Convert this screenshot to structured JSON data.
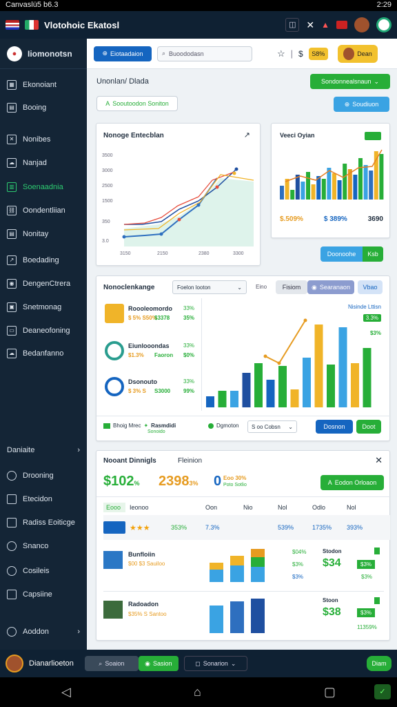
{
  "status_bar": {
    "left": "Canvaslü5 b6.3",
    "time": "2:29"
  },
  "app": {
    "title": "Vlotohoic Ekatosl"
  },
  "sidebar": {
    "brand": "Iiomonotsn",
    "items": [
      {
        "label": "Ekonoiant",
        "icon": "dashboard-icon"
      },
      {
        "label": "Booing",
        "icon": "calendar-icon"
      },
      {
        "label": "Nonibes",
        "icon": "close-box-icon"
      },
      {
        "label": "Nanjad",
        "icon": "cloud-icon"
      },
      {
        "label": "Soenaadnia",
        "icon": "chart-icon",
        "active": true
      },
      {
        "label": "Oondentliian",
        "icon": "link-icon"
      },
      {
        "label": "Nonitay",
        "icon": "document-icon"
      },
      {
        "label": "Boedading",
        "icon": "share-icon"
      },
      {
        "label": "DengenCtrera",
        "icon": "group-icon"
      },
      {
        "label": "Snetmonag",
        "icon": "image-icon"
      },
      {
        "label": "Deaneofoning",
        "icon": "card-icon"
      },
      {
        "label": "Bedanfanno",
        "icon": "cloud-upload-icon"
      }
    ],
    "section_title": "Daniaite",
    "sub_items": [
      {
        "label": "Drooning",
        "icon": "clock-icon"
      },
      {
        "label": "Etecidon",
        "icon": "list-icon"
      },
      {
        "label": "Radiss Eoiticge",
        "icon": "laptop-icon"
      },
      {
        "label": "Snanco",
        "icon": "target-icon"
      },
      {
        "label": "Cosileis",
        "icon": "gear-icon"
      },
      {
        "label": "Capsiine",
        "icon": "layers-icon"
      }
    ],
    "footer_item": "Aoddon"
  },
  "topbar": {
    "primary_button": "Eiotaadaion",
    "search_placeholder": "Buoododasn",
    "badge": "S8%",
    "profile_label": "Dean"
  },
  "page": {
    "title": "Unonlan/ Dlada",
    "action_button": "Sondonnealsnaun",
    "chip_label": "Sooutoodon Soniton",
    "secondary_button": "Soudiuon"
  },
  "card1": {
    "title": "Nonoge Entecblan",
    "yticks": [
      "3500",
      "3000",
      "2500",
      "1500",
      "350",
      "3.0"
    ],
    "xticks": [
      "3150",
      "2150",
      "2380",
      "3300"
    ]
  },
  "card2": {
    "title": "Veeci Oyian",
    "badge": "",
    "stats": [
      {
        "v": "$.509%",
        "c": "#e69b20"
      },
      {
        "v": "$ 389%",
        "c": "#1565c0"
      },
      {
        "v": "3690",
        "c": "#1f2d3d"
      }
    ],
    "btn_a": "Doonoohe",
    "btn_b": "Ksb"
  },
  "card3": {
    "title": "Nonoclenkange",
    "dropdown": "Foelon looton",
    "filter_label": "Eino",
    "filter_button": "Fisiom",
    "toggle_label": "Searanaon",
    "view_button": "Vbao",
    "legend_title": "Nisinde Lttisn",
    "legend_value": "3.3%",
    "legend_sub": "$3%",
    "items": [
      {
        "name": "Roooleomordo",
        "sub": "$ 5% S50%",
        "v1": "$3378",
        "p1": "33%",
        "p2": "35%"
      },
      {
        "name": "Eiunlooondas",
        "sub": "$1.3%",
        "v1": "Faoron",
        "p1": "33%",
        "p2": "$0%"
      },
      {
        "name": "Dsonouto",
        "sub": "$ 3% S",
        "v1": "S3000",
        "p1": "33%",
        "p2": "99%"
      }
    ],
    "footer_left": "Bhoig Mrec",
    "footer_left2": "Rasmdidi",
    "footer_left_sub": "Sonoido",
    "footer_mid": "Dgmoton",
    "footer_select": "S oo Cobsn",
    "footer_btn1": "Dosnon",
    "footer_btn2": "Doot"
  },
  "card4": {
    "title": "Nooant Dinnigls",
    "title2": "Fleinion",
    "stat1": "$102",
    "stat1_sub": "%",
    "stat2": "2398",
    "stat2_sub": "3%",
    "stat3": "0",
    "stat3_sub": "Eoo 30%",
    "stat3_sub2": "Poto Sotlio",
    "button": "Eodon Orloaon",
    "table_head": [
      "Eooo",
      "Ieonoo",
      "Oon",
      "Nio",
      "Nol",
      "Odlo",
      "Nol"
    ],
    "row1": {
      "stars": "★★★",
      "pct": "353%",
      "c1": "7.3%",
      "c2": "539%",
      "c3": "1735%",
      "c4": "393%"
    },
    "row2": {
      "name": "Bunfloiin",
      "sub": "$00 $3 Sauiloo",
      "head": "Stodon",
      "p1": "$04%",
      "p2": "$3%",
      "p3": "$3%",
      "big": "$34",
      "tag": "$3%",
      "tag2": "$3%"
    },
    "row3": {
      "name": "Radoadon",
      "sub": "$35% S Santoo",
      "head": "Stoon",
      "big": "$38",
      "tag": "$3%",
      "tag2": "11359%"
    }
  },
  "bottom": {
    "name": "Dianarlioeton",
    "btn1": "Soaion",
    "btn2": "Sasion",
    "select": "Sonarion",
    "btn3": "Diam"
  }
}
